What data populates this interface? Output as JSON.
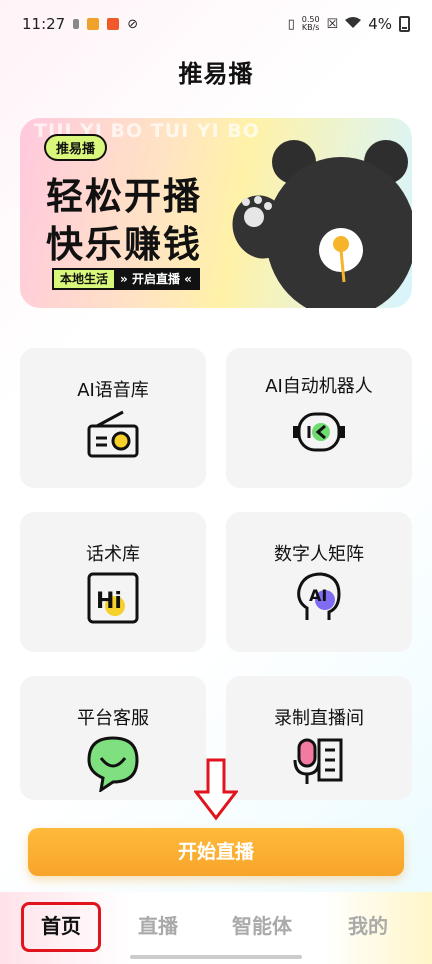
{
  "status_bar": {
    "time": "11:27",
    "net_speed": "0.50",
    "net_unit": "KB/s",
    "battery": "4%"
  },
  "app_title": "推易播",
  "banner": {
    "bg_text": "TUI YI BO TUI YI BO",
    "badge": "推易播",
    "line1": "轻松开播",
    "line2": "快乐赚钱",
    "tag_left": "本地生活",
    "tag_right": "» 开启直播 «"
  },
  "cards": [
    {
      "label": "AI语音库",
      "icon": "radio-icon"
    },
    {
      "label": "AI自动机器人",
      "icon": "robot-icon"
    },
    {
      "label": "话术库",
      "icon": "hi-card-icon"
    },
    {
      "label": "数字人矩阵",
      "icon": "ai-head-icon"
    },
    {
      "label": "平台客服",
      "icon": "chat-smile-icon"
    },
    {
      "label": "录制直播间",
      "icon": "microphone-icon"
    }
  ],
  "start_button": "开始直播",
  "nav": {
    "home": "首页",
    "live": "直播",
    "agent": "智能体",
    "mine": "我的"
  },
  "colors": {
    "accent": "#f7a52a",
    "lime": "#d9f77a",
    "highlight": "#e1141d"
  }
}
